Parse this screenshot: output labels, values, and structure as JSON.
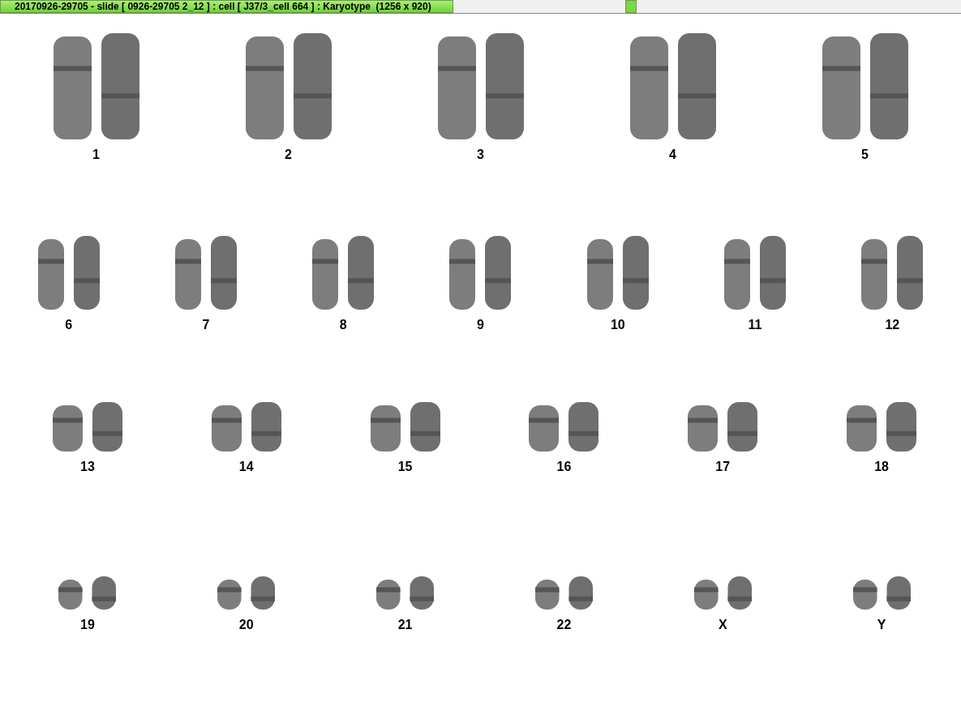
{
  "title_bar": {
    "title": "20170926-29705 - slide [ 0926-29705 2_12 ] : cell [ J37/3_cell 664 ] : Karyotype  (1256 x 920)"
  },
  "rows": [
    {
      "chromosomes": [
        {
          "label": "1"
        },
        {
          "label": "2"
        },
        {
          "label": "3"
        },
        {
          "label": "4"
        },
        {
          "label": "5"
        }
      ]
    },
    {
      "chromosomes": [
        {
          "label": "6"
        },
        {
          "label": "7"
        },
        {
          "label": "8"
        },
        {
          "label": "9"
        },
        {
          "label": "10"
        },
        {
          "label": "11"
        },
        {
          "label": "12"
        }
      ]
    },
    {
      "chromosomes": [
        {
          "label": "13"
        },
        {
          "label": "14"
        },
        {
          "label": "15"
        },
        {
          "label": "16"
        },
        {
          "label": "17"
        },
        {
          "label": "18"
        }
      ]
    },
    {
      "chromosomes": [
        {
          "label": "19"
        },
        {
          "label": "20"
        },
        {
          "label": "21"
        },
        {
          "label": "22"
        },
        {
          "label": "X"
        },
        {
          "label": "Y"
        }
      ]
    }
  ]
}
